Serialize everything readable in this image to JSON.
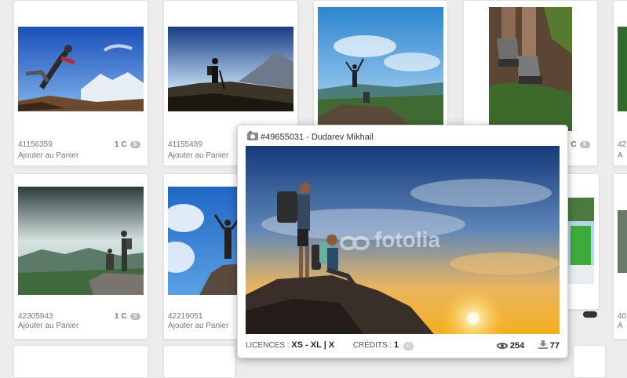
{
  "grid": {
    "cards": [
      {
        "id": "41156359",
        "price": "1 C",
        "badge": "S",
        "add": "Ajouter au Panier"
      },
      {
        "id": "41155489",
        "price": "",
        "badge": "",
        "add": "Ajouter au Panier"
      },
      {
        "id": "",
        "price": "",
        "badge": "",
        "add": ""
      },
      {
        "id": "",
        "price": "2 C",
        "badge": "S",
        "add": ""
      },
      {
        "id": "42",
        "price": "",
        "badge": "",
        "add": "A"
      },
      {
        "id": "42305943",
        "price": "1 C",
        "badge": "S",
        "add": "Ajouter au Panier"
      },
      {
        "id": "42219051",
        "price": "",
        "badge": "",
        "add": "Ajouter au Panier"
      },
      {
        "id": "40",
        "price": "",
        "badge": "",
        "add": "A"
      }
    ]
  },
  "popup": {
    "title": "#49655031 - Dudarev Mikhail",
    "watermark": "fotolia",
    "licences_label": "LICENCES :",
    "licences_value": "XS - XL | X",
    "credits_label": "CRÉDITS :",
    "credits_value": "1",
    "credits_badge": "C",
    "views": "254",
    "downloads": "77"
  },
  "icons": [
    "camera-icon",
    "eye-icon",
    "download-icon",
    "credit-badge-icon",
    "standard-badge-icon"
  ],
  "colors": {
    "background": "#ececec",
    "card": "#ffffff",
    "text": "#777777"
  }
}
